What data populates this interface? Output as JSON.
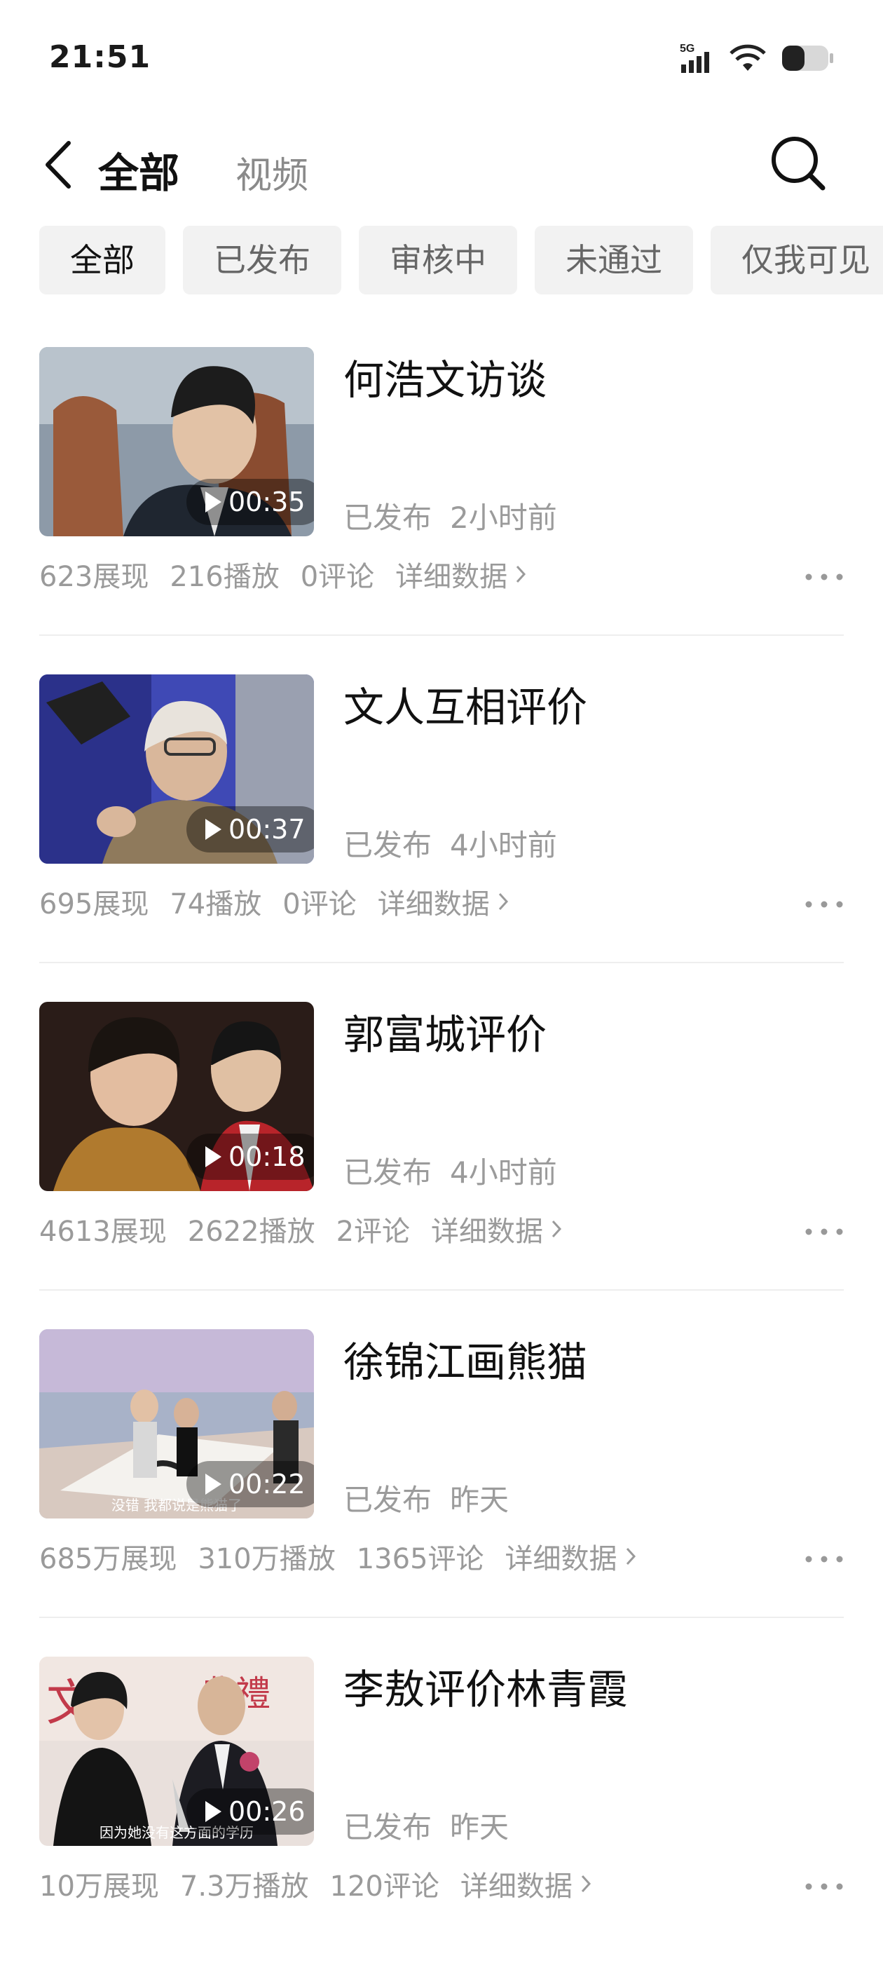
{
  "status_bar": {
    "time": "21:51",
    "network": "5G",
    "icons": [
      "signal-icon",
      "wifi-icon",
      "battery-icon"
    ]
  },
  "header": {
    "title": "全部",
    "subtitle": "视频",
    "icons": [
      "back-icon",
      "search-icon"
    ]
  },
  "filters": [
    "全部",
    "已发布",
    "审核中",
    "未通过",
    "仅我可见"
  ],
  "active_filter": "全部",
  "videos": [
    {
      "title": "何浩文访谈",
      "duration": "00:35",
      "status": "已发布",
      "time": "2小时前",
      "views": "623展现",
      "plays": "216播放",
      "comments": "0评论",
      "detail": "详细数据"
    },
    {
      "title": "文人互相评价",
      "duration": "00:37",
      "status": "已发布",
      "time": "4小时前",
      "views": "695展现",
      "plays": "74播放",
      "comments": "0评论",
      "detail": "详细数据"
    },
    {
      "title": "郭富城评价",
      "duration": "00:18",
      "status": "已发布",
      "time": "4小时前",
      "views": "4613展现",
      "plays": "2622播放",
      "comments": "2评论",
      "detail": "详细数据"
    },
    {
      "title": "徐锦江画熊猫",
      "duration": "00:22",
      "status": "已发布",
      "time": "昨天",
      "views": "685万展现",
      "plays": "310万播放",
      "comments": "1365评论",
      "detail": "详细数据",
      "caption": "没错 我都说是熊猫了"
    },
    {
      "title": "李敖评价林青霞",
      "duration": "00:26",
      "status": "已发布",
      "time": "昨天",
      "views": "10万展现",
      "plays": "7.3万播放",
      "comments": "120评论",
      "detail": "详细数据",
      "caption": "因为她没有这方面的学历"
    }
  ],
  "colors": {
    "chip_bg": "#f2f2f2",
    "meta_text": "#9b9b9b",
    "title_text": "#111111"
  }
}
